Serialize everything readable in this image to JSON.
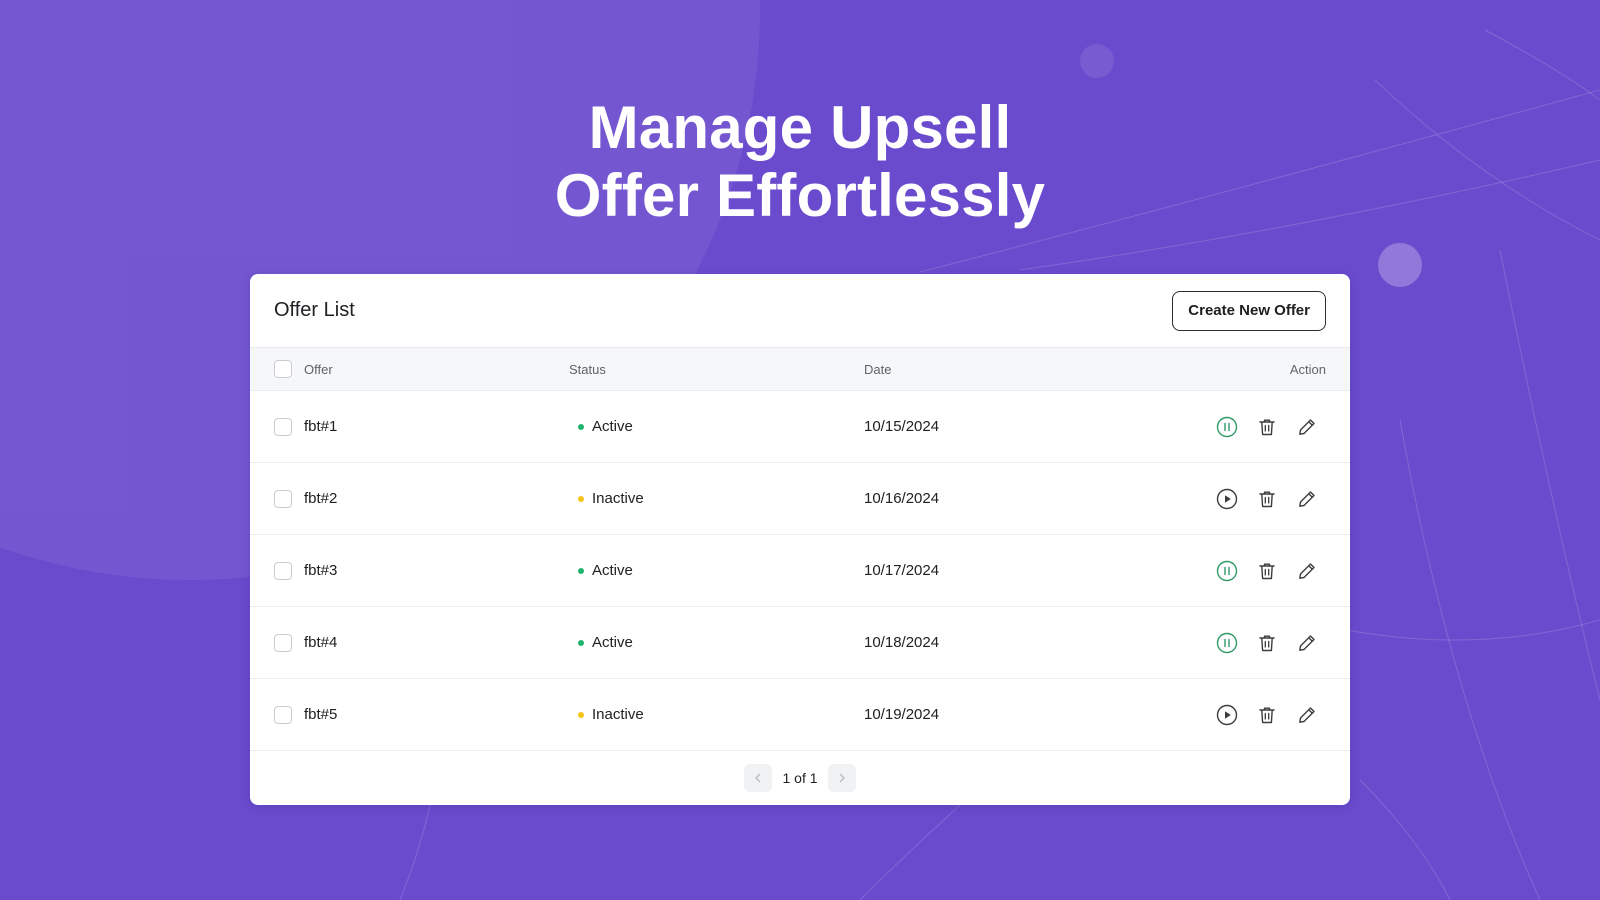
{
  "headline": {
    "line1": "Manage Upsell",
    "line2": "Offer Effortlessly"
  },
  "card": {
    "title": "Offer List",
    "create_button": "Create New Offer"
  },
  "table": {
    "headers": {
      "offer": "Offer",
      "status": "Status",
      "date": "Date",
      "action": "Action"
    },
    "rows": [
      {
        "offer": "fbt#1",
        "status": "Active",
        "date": "10/15/2024",
        "toggle_icon": "pause-icon"
      },
      {
        "offer": "fbt#2",
        "status": "Inactive",
        "date": "10/16/2024",
        "toggle_icon": "play-icon"
      },
      {
        "offer": "fbt#3",
        "status": "Active",
        "date": "10/17/2024",
        "toggle_icon": "pause-icon"
      },
      {
        "offer": "fbt#4",
        "status": "Active",
        "date": "10/18/2024",
        "toggle_icon": "pause-icon"
      },
      {
        "offer": "fbt#5",
        "status": "Inactive",
        "date": "10/19/2024",
        "toggle_icon": "play-icon"
      }
    ]
  },
  "pagination": {
    "label": "1 of 1"
  },
  "colors": {
    "background": "#6a4bcd",
    "active_dot": "#1fb66b",
    "inactive_dot": "#f5c518",
    "pause_icon": "#2e9a66",
    "icon_default": "#3c3c3c"
  }
}
